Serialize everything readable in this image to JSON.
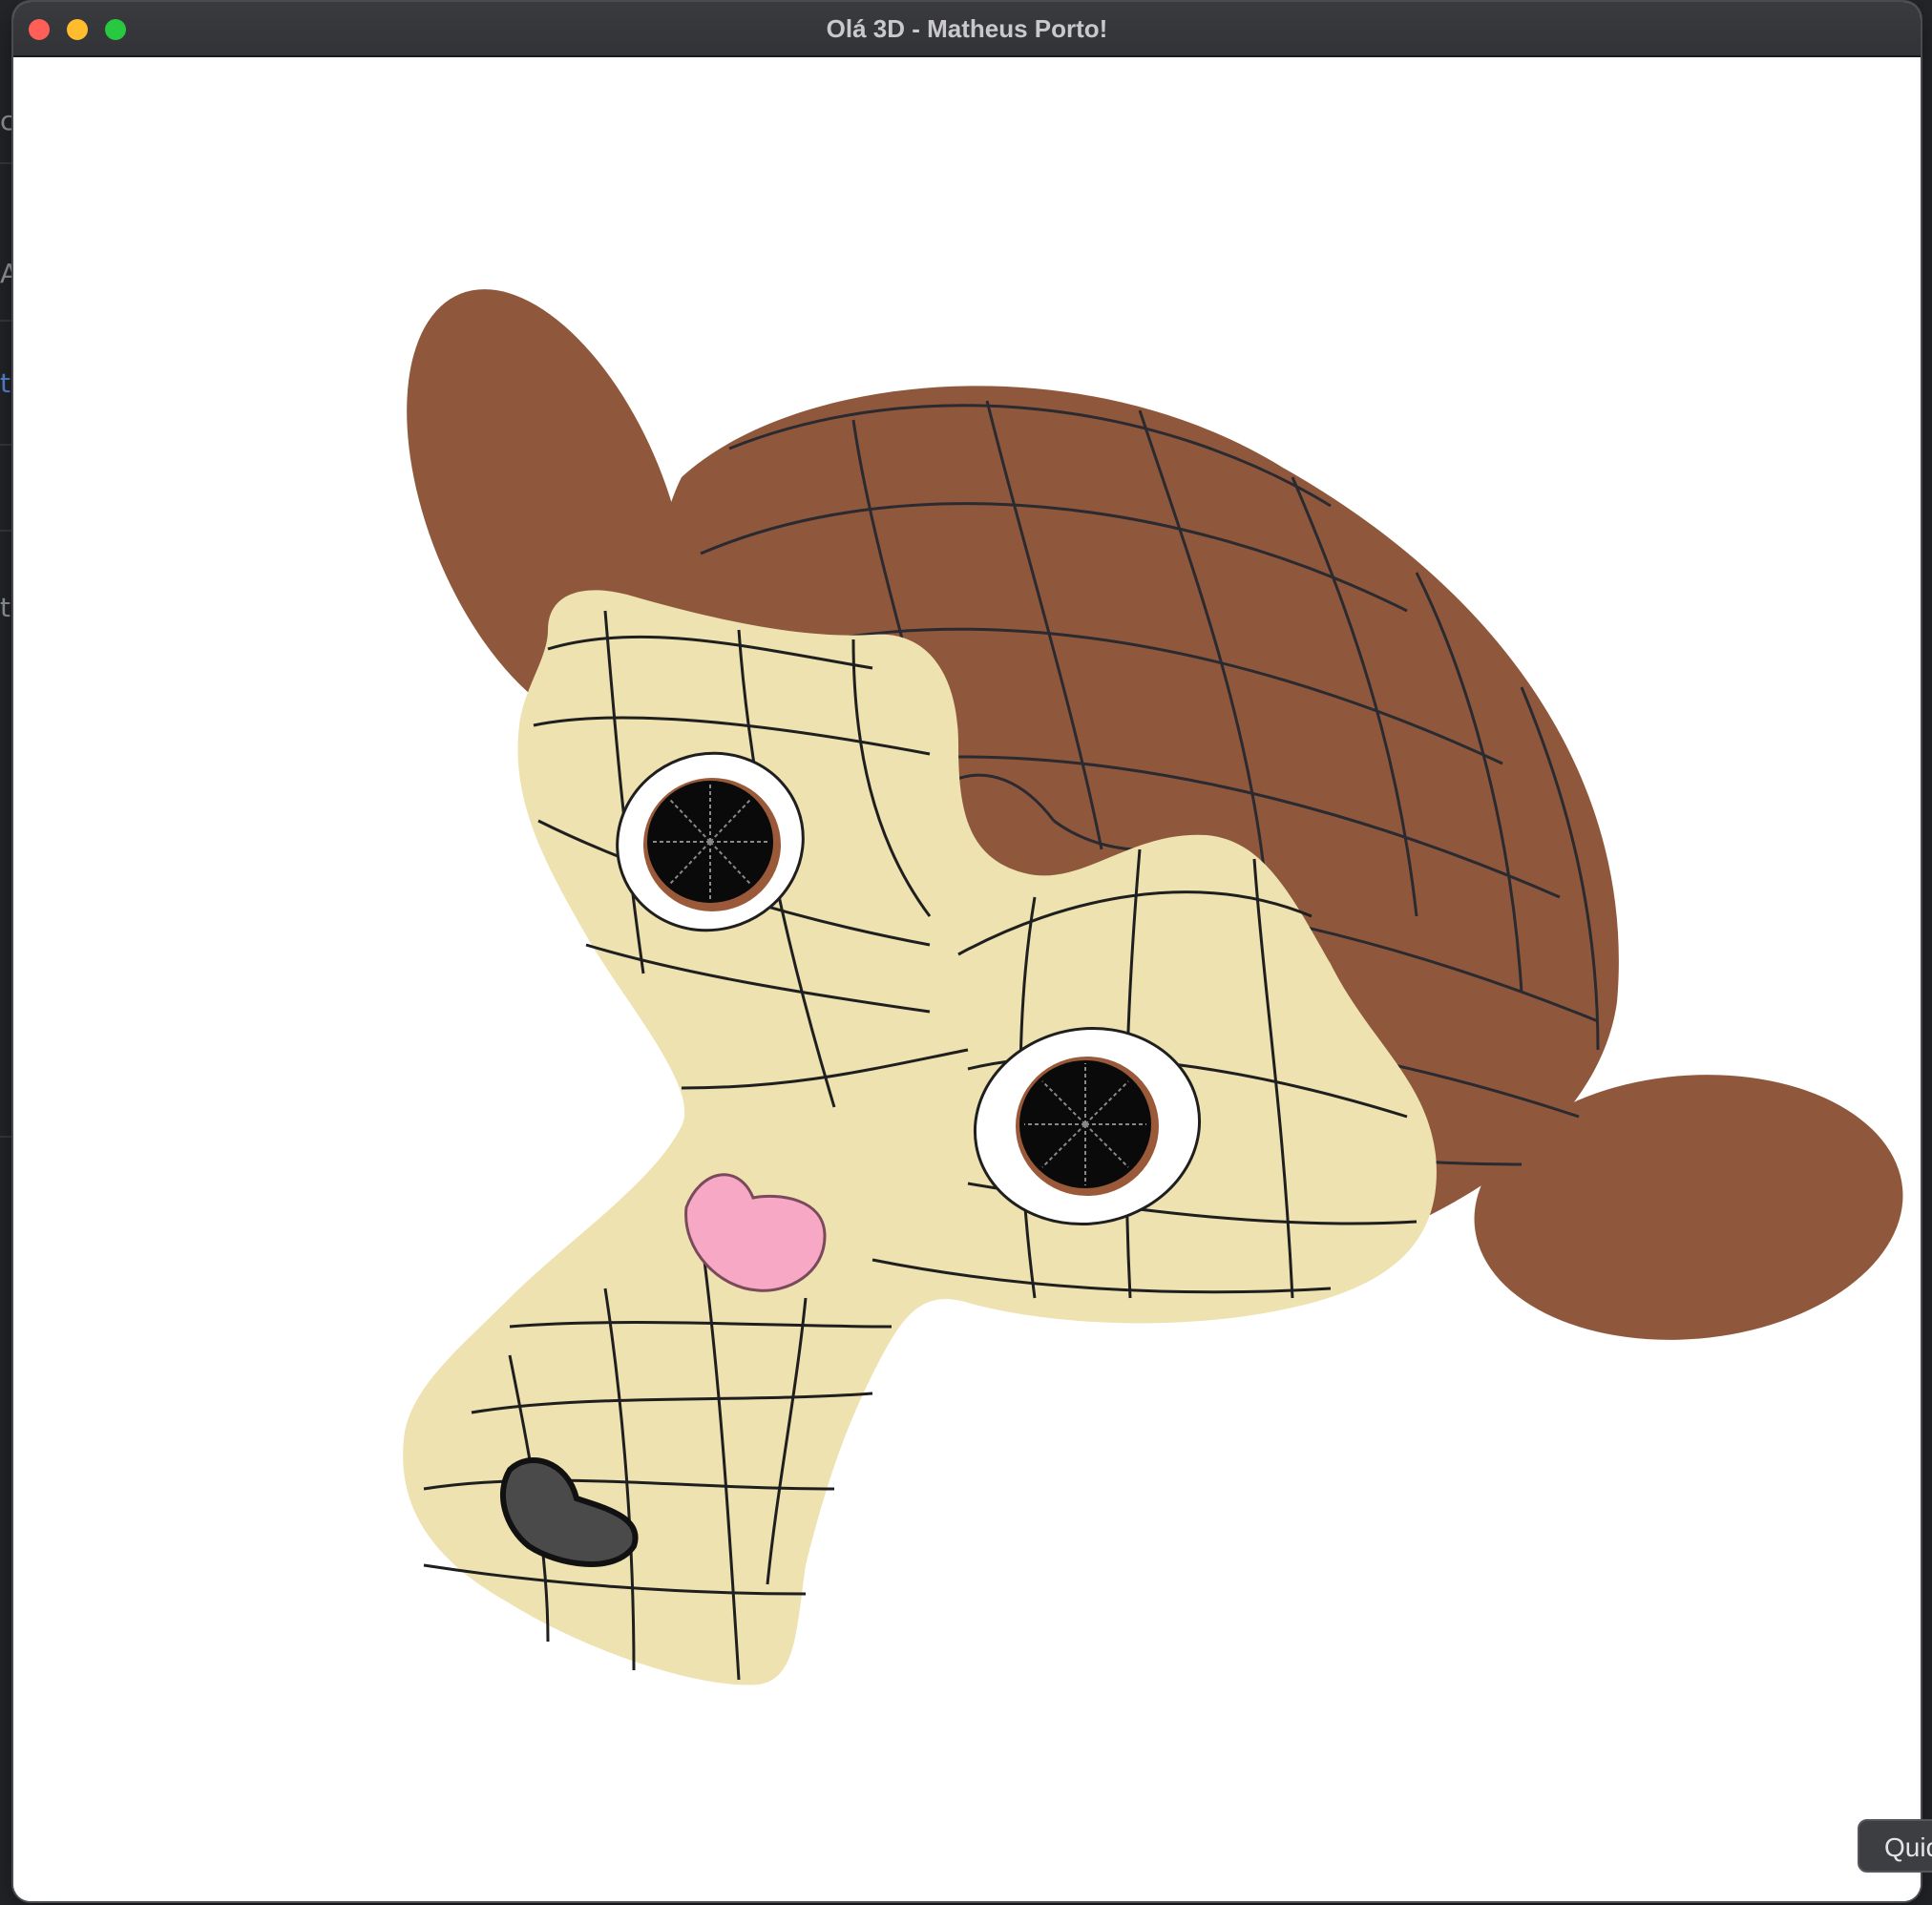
{
  "window": {
    "title": "Olá 3D - Matheus Porto!"
  },
  "background_app": {
    "glyphs": [
      "c",
      "A",
      "t",
      "t"
    ]
  },
  "scene": {
    "object": "monkey-head-mesh",
    "colors": {
      "ears_and_skull": "#8f583c",
      "face": "#ede2b0",
      "eye_white": "#ffffff",
      "pupil": "#0a0a0a",
      "iris_ring": "#9a5a3a",
      "nose": "#f7a8c4",
      "wireframe": "#1a1a1a"
    }
  },
  "dock_button": {
    "label": "Quic"
  }
}
